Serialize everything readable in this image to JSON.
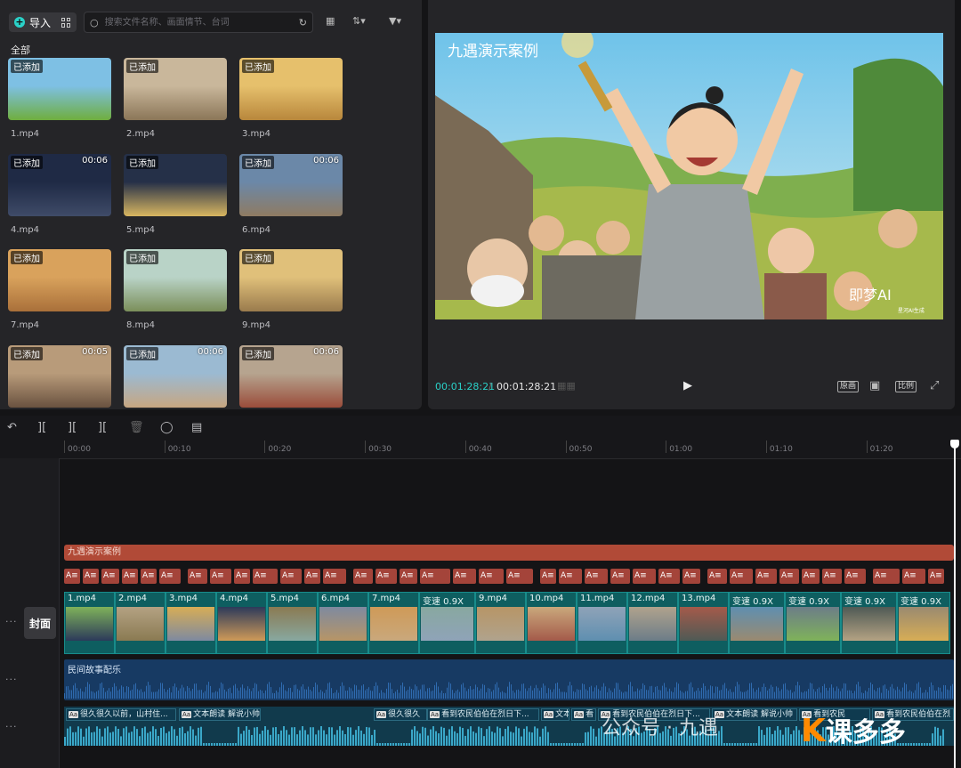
{
  "media": {
    "import_label": "导入",
    "search_placeholder": "搜索文件名称、画面情节、台词",
    "all_label": "全部",
    "clips": [
      {
        "name": "1.mp4",
        "badge": "已添加",
        "duration": ""
      },
      {
        "name": "2.mp4",
        "badge": "已添加",
        "duration": ""
      },
      {
        "name": "3.mp4",
        "badge": "已添加",
        "duration": ""
      },
      {
        "name": "4.mp4",
        "badge": "已添加",
        "duration": "00:06"
      },
      {
        "name": "5.mp4",
        "badge": "已添加",
        "duration": ""
      },
      {
        "name": "6.mp4",
        "badge": "已添加",
        "duration": "00:06"
      },
      {
        "name": "7.mp4",
        "badge": "已添加",
        "duration": ""
      },
      {
        "name": "8.mp4",
        "badge": "已添加",
        "duration": ""
      },
      {
        "name": "9.mp4",
        "badge": "已添加",
        "duration": ""
      },
      {
        "name": "",
        "badge": "已添加",
        "duration": "00:05"
      },
      {
        "name": "",
        "badge": "已添加",
        "duration": "00:06"
      },
      {
        "name": "",
        "badge": "已添加",
        "duration": "00:06"
      }
    ]
  },
  "player": {
    "overlay_title": "九遇演示案例",
    "brand": "即梦AI",
    "brand_sub": "星河AI生成",
    "current_time": "00:01:28:21",
    "separator": "/",
    "total_time": "00:01:28:21",
    "btn_original": "原画",
    "btn_ratio": "比例"
  },
  "timeline": {
    "ruler": [
      "00:00",
      "00:10",
      "00:20",
      "00:30",
      "00:40",
      "00:50",
      "01:00",
      "01:10",
      "01:20"
    ],
    "title_clip": "九遇演示案例",
    "text_chip": "A≡",
    "video_clips": [
      "1.mp4",
      "2.mp4",
      "3.mp4",
      "4.mp4",
      "5.mp4",
      "6.mp4",
      "7.mp4",
      "变速 0.9X",
      "9.mp4",
      "10.mp4",
      "11.mp4",
      "12.mp4",
      "13.mp4",
      "变速 0.9X",
      "变速 0.9X",
      "变速 0.9X",
      "变速 0.9X"
    ],
    "cover_label": "封面",
    "audio_label": "民间故事配乐",
    "subtitles": [
      "很久很久以前，山村住...",
      "文本朗读 解说小帅",
      "很久很久",
      "看到农民伯伯在烈日下...",
      "文本朗",
      "看",
      "看到农民伯伯在烈日下...",
      "文本朗读 解说小帅",
      "看到农民",
      "看到农民伯伯在烈"
    ]
  },
  "watermark": {
    "text": "公众号 · 九遇",
    "logo": "K",
    "site": "课多多"
  },
  "colors": {
    "accent": "#2ad2c9",
    "title_track": "#b14a37",
    "video_track": "#0e5e60",
    "audio_track": "#173a63"
  }
}
